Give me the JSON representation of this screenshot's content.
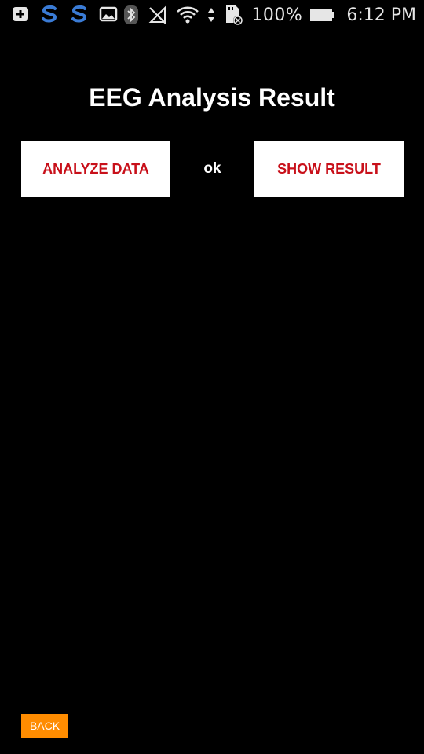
{
  "status_bar": {
    "left_icons": [
      "add-box-icon",
      "s-app-icon",
      "s-app-icon",
      "image-icon"
    ],
    "right_icons": [
      "bluetooth-icon",
      "no-signal-icon",
      "wifi-icon",
      "data-arrows-icon",
      "sd-card-icon",
      "battery-icon"
    ],
    "battery_percent": "100%",
    "time": "6:12 PM"
  },
  "page": {
    "title": "EEG Analysis Result",
    "analyze_button_label": "ANALYZE DATA",
    "status_text": "ok",
    "show_result_button_label": "SHOW RESULT",
    "back_button_label": "BACK"
  },
  "colors": {
    "background": "#000000",
    "button_bg": "#ffffff",
    "button_text": "#c8101a",
    "back_button_bg": "#ff8c00",
    "s_app_icon": "#3a7bd5"
  }
}
